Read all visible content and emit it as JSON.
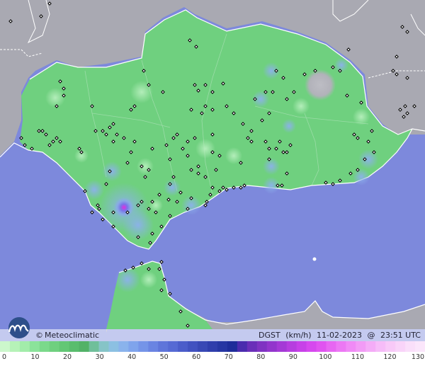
{
  "map": {
    "variable": "DGST",
    "unit": "(km/h)",
    "date": "11-02-2023",
    "at": "@",
    "time": "23:51 UTC",
    "brand": "Meteoclimatic",
    "copyright_symbol": "©",
    "sea_color": "#7d89dc",
    "land_color": "#6fd07f",
    "foreign_land_color": "#a9a9b2",
    "gust_hotspot_color": "#d94ad8"
  },
  "scale": {
    "labels": [
      "0",
      "10",
      "20",
      "30",
      "40",
      "50",
      "60",
      "70",
      "80",
      "90",
      "100",
      "110",
      "120",
      "130"
    ],
    "colors": [
      "#ccf7cc",
      "#b6f2b8",
      "#a2ecaa",
      "#8be39a",
      "#7bd98b",
      "#6fd07f",
      "#63c775",
      "#59bd6d",
      "#52b267",
      "#6fbf9a",
      "#86c4c7",
      "#8cc0e2",
      "#8ab3ec",
      "#7fa4ec",
      "#7594e8",
      "#6a84e2",
      "#5f75da",
      "#566ad4",
      "#4b5dca",
      "#4152c0",
      "#3848b5",
      "#2f3eac",
      "#2636a3",
      "#1e2d9a",
      "#4a2cae",
      "#6a2fb9",
      "#7f33c2",
      "#9236cc",
      "#a43ad6",
      "#b63edf",
      "#c741e8",
      "#d648ee",
      "#e053f0",
      "#e766f2",
      "#ec78f4",
      "#f08af6",
      "#f29bf6",
      "#f4acf7",
      "#f6bcf8",
      "#f8c9f8",
      "#f9d4f9",
      "#fadffa",
      "#fbe6fb"
    ]
  }
}
